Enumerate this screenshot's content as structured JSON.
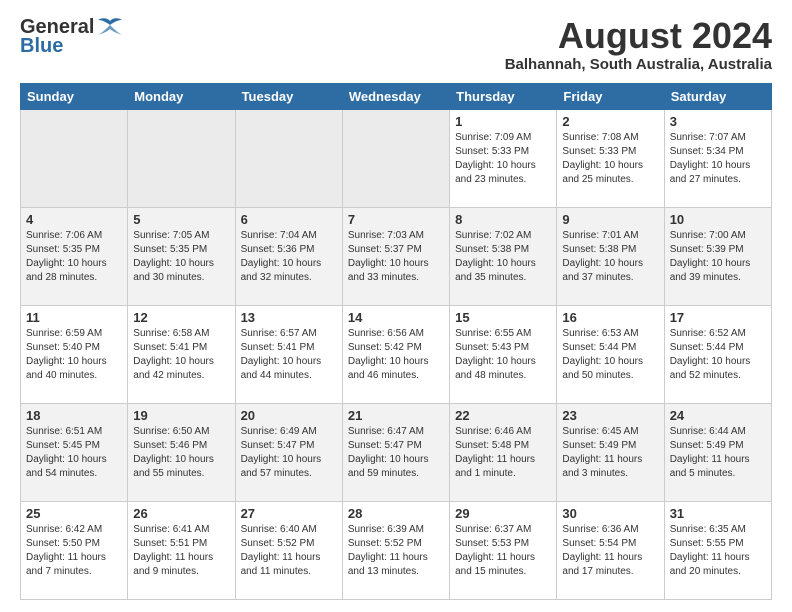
{
  "header": {
    "logo_general": "General",
    "logo_blue": "Blue",
    "month_year": "August 2024",
    "location": "Balhannah, South Australia, Australia"
  },
  "weekdays": [
    "Sunday",
    "Monday",
    "Tuesday",
    "Wednesday",
    "Thursday",
    "Friday",
    "Saturday"
  ],
  "weeks": [
    {
      "style": "white",
      "days": [
        {
          "num": "",
          "info": "",
          "empty": true
        },
        {
          "num": "",
          "info": "",
          "empty": true
        },
        {
          "num": "",
          "info": "",
          "empty": true
        },
        {
          "num": "",
          "info": "",
          "empty": true
        },
        {
          "num": "1",
          "info": "Sunrise: 7:09 AM\nSunset: 5:33 PM\nDaylight: 10 hours\nand 23 minutes.",
          "empty": false
        },
        {
          "num": "2",
          "info": "Sunrise: 7:08 AM\nSunset: 5:33 PM\nDaylight: 10 hours\nand 25 minutes.",
          "empty": false
        },
        {
          "num": "3",
          "info": "Sunrise: 7:07 AM\nSunset: 5:34 PM\nDaylight: 10 hours\nand 27 minutes.",
          "empty": false
        }
      ]
    },
    {
      "style": "gray",
      "days": [
        {
          "num": "4",
          "info": "Sunrise: 7:06 AM\nSunset: 5:35 PM\nDaylight: 10 hours\nand 28 minutes.",
          "empty": false
        },
        {
          "num": "5",
          "info": "Sunrise: 7:05 AM\nSunset: 5:35 PM\nDaylight: 10 hours\nand 30 minutes.",
          "empty": false
        },
        {
          "num": "6",
          "info": "Sunrise: 7:04 AM\nSunset: 5:36 PM\nDaylight: 10 hours\nand 32 minutes.",
          "empty": false
        },
        {
          "num": "7",
          "info": "Sunrise: 7:03 AM\nSunset: 5:37 PM\nDaylight: 10 hours\nand 33 minutes.",
          "empty": false
        },
        {
          "num": "8",
          "info": "Sunrise: 7:02 AM\nSunset: 5:38 PM\nDaylight: 10 hours\nand 35 minutes.",
          "empty": false
        },
        {
          "num": "9",
          "info": "Sunrise: 7:01 AM\nSunset: 5:38 PM\nDaylight: 10 hours\nand 37 minutes.",
          "empty": false
        },
        {
          "num": "10",
          "info": "Sunrise: 7:00 AM\nSunset: 5:39 PM\nDaylight: 10 hours\nand 39 minutes.",
          "empty": false
        }
      ]
    },
    {
      "style": "white",
      "days": [
        {
          "num": "11",
          "info": "Sunrise: 6:59 AM\nSunset: 5:40 PM\nDaylight: 10 hours\nand 40 minutes.",
          "empty": false
        },
        {
          "num": "12",
          "info": "Sunrise: 6:58 AM\nSunset: 5:41 PM\nDaylight: 10 hours\nand 42 minutes.",
          "empty": false
        },
        {
          "num": "13",
          "info": "Sunrise: 6:57 AM\nSunset: 5:41 PM\nDaylight: 10 hours\nand 44 minutes.",
          "empty": false
        },
        {
          "num": "14",
          "info": "Sunrise: 6:56 AM\nSunset: 5:42 PM\nDaylight: 10 hours\nand 46 minutes.",
          "empty": false
        },
        {
          "num": "15",
          "info": "Sunrise: 6:55 AM\nSunset: 5:43 PM\nDaylight: 10 hours\nand 48 minutes.",
          "empty": false
        },
        {
          "num": "16",
          "info": "Sunrise: 6:53 AM\nSunset: 5:44 PM\nDaylight: 10 hours\nand 50 minutes.",
          "empty": false
        },
        {
          "num": "17",
          "info": "Sunrise: 6:52 AM\nSunset: 5:44 PM\nDaylight: 10 hours\nand 52 minutes.",
          "empty": false
        }
      ]
    },
    {
      "style": "gray",
      "days": [
        {
          "num": "18",
          "info": "Sunrise: 6:51 AM\nSunset: 5:45 PM\nDaylight: 10 hours\nand 54 minutes.",
          "empty": false
        },
        {
          "num": "19",
          "info": "Sunrise: 6:50 AM\nSunset: 5:46 PM\nDaylight: 10 hours\nand 55 minutes.",
          "empty": false
        },
        {
          "num": "20",
          "info": "Sunrise: 6:49 AM\nSunset: 5:47 PM\nDaylight: 10 hours\nand 57 minutes.",
          "empty": false
        },
        {
          "num": "21",
          "info": "Sunrise: 6:47 AM\nSunset: 5:47 PM\nDaylight: 10 hours\nand 59 minutes.",
          "empty": false
        },
        {
          "num": "22",
          "info": "Sunrise: 6:46 AM\nSunset: 5:48 PM\nDaylight: 11 hours\nand 1 minute.",
          "empty": false
        },
        {
          "num": "23",
          "info": "Sunrise: 6:45 AM\nSunset: 5:49 PM\nDaylight: 11 hours\nand 3 minutes.",
          "empty": false
        },
        {
          "num": "24",
          "info": "Sunrise: 6:44 AM\nSunset: 5:49 PM\nDaylight: 11 hours\nand 5 minutes.",
          "empty": false
        }
      ]
    },
    {
      "style": "white",
      "days": [
        {
          "num": "25",
          "info": "Sunrise: 6:42 AM\nSunset: 5:50 PM\nDaylight: 11 hours\nand 7 minutes.",
          "empty": false
        },
        {
          "num": "26",
          "info": "Sunrise: 6:41 AM\nSunset: 5:51 PM\nDaylight: 11 hours\nand 9 minutes.",
          "empty": false
        },
        {
          "num": "27",
          "info": "Sunrise: 6:40 AM\nSunset: 5:52 PM\nDaylight: 11 hours\nand 11 minutes.",
          "empty": false
        },
        {
          "num": "28",
          "info": "Sunrise: 6:39 AM\nSunset: 5:52 PM\nDaylight: 11 hours\nand 13 minutes.",
          "empty": false
        },
        {
          "num": "29",
          "info": "Sunrise: 6:37 AM\nSunset: 5:53 PM\nDaylight: 11 hours\nand 15 minutes.",
          "empty": false
        },
        {
          "num": "30",
          "info": "Sunrise: 6:36 AM\nSunset: 5:54 PM\nDaylight: 11 hours\nand 17 minutes.",
          "empty": false
        },
        {
          "num": "31",
          "info": "Sunrise: 6:35 AM\nSunset: 5:55 PM\nDaylight: 11 hours\nand 20 minutes.",
          "empty": false
        }
      ]
    }
  ]
}
